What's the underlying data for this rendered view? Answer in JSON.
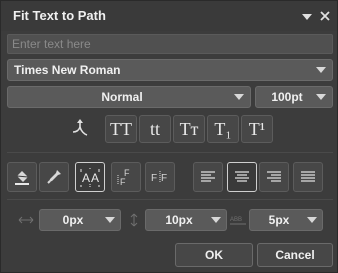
{
  "window": {
    "title": "Fit Text to Path"
  },
  "text_input": {
    "placeholder": "Enter text here"
  },
  "font": {
    "selected": "Times New Roman"
  },
  "style": {
    "selected": "Normal"
  },
  "size": {
    "selected": "100pt"
  },
  "case_buttons": [
    {
      "name": "all-caps",
      "label": "TT"
    },
    {
      "name": "lowercase",
      "label": "tt"
    },
    {
      "name": "small-caps",
      "label": "Tт"
    },
    {
      "name": "subscript",
      "label": "T₁"
    },
    {
      "name": "superscript",
      "label": "T¹"
    }
  ],
  "spacing": {
    "horizontal": "0px",
    "vertical": "10px",
    "letter": "5px"
  },
  "buttons": {
    "ok": "OK",
    "cancel": "Cancel"
  },
  "colors": {
    "panel": "#3c3c3c",
    "field": "#5a5a5a",
    "text": "#f0f0f0",
    "active_border": "#cfcfcf"
  }
}
